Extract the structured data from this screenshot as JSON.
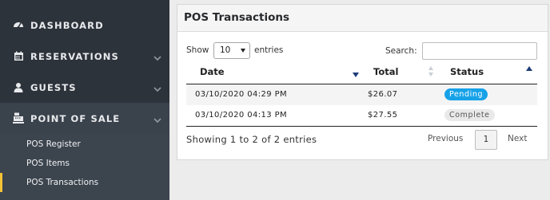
{
  "sidebar": {
    "items": [
      {
        "label": "DASHBOARD",
        "icon": "dashboard-gauge-icon",
        "has_children": false
      },
      {
        "label": "RESERVATIONS",
        "icon": "calendar-icon",
        "has_children": true
      },
      {
        "label": "GUESTS",
        "icon": "user-icon",
        "has_children": true
      },
      {
        "label": "POINT OF SALE",
        "icon": "cash-register-icon",
        "has_children": true,
        "expanded": true
      }
    ],
    "pos_submenu": [
      {
        "label": "POS Register"
      },
      {
        "label": "POS Items"
      },
      {
        "label": "POS Transactions",
        "active": true
      }
    ]
  },
  "panel": {
    "title": "POS Transactions",
    "show_label": "Show",
    "entries_per_page": "10",
    "entries_label": "entries",
    "search_label": "Search:",
    "search_value": "",
    "columns": [
      "Date",
      "Total",
      "Status"
    ],
    "sort": {
      "Date": "desc",
      "Total": "none",
      "Status": "asc"
    },
    "rows": [
      {
        "date": "03/10/2020 04:29 PM",
        "total": "$26.07",
        "status": "Pending"
      },
      {
        "date": "03/10/2020 04:13 PM",
        "total": "$27.55",
        "status": "Complete"
      }
    ],
    "info": "Showing 1 to 2 of 2 entries",
    "pagination": {
      "previous": "Previous",
      "current_page": "1",
      "next": "Next"
    }
  },
  "colors": {
    "sidebar_bg": "#2d333b",
    "submenu_bg": "#3c444e",
    "active_accent": "#f4c234",
    "pending_badge": "#17a2e8",
    "complete_badge": "#e9e9e9",
    "sort_arrow": "#1d3c78"
  }
}
